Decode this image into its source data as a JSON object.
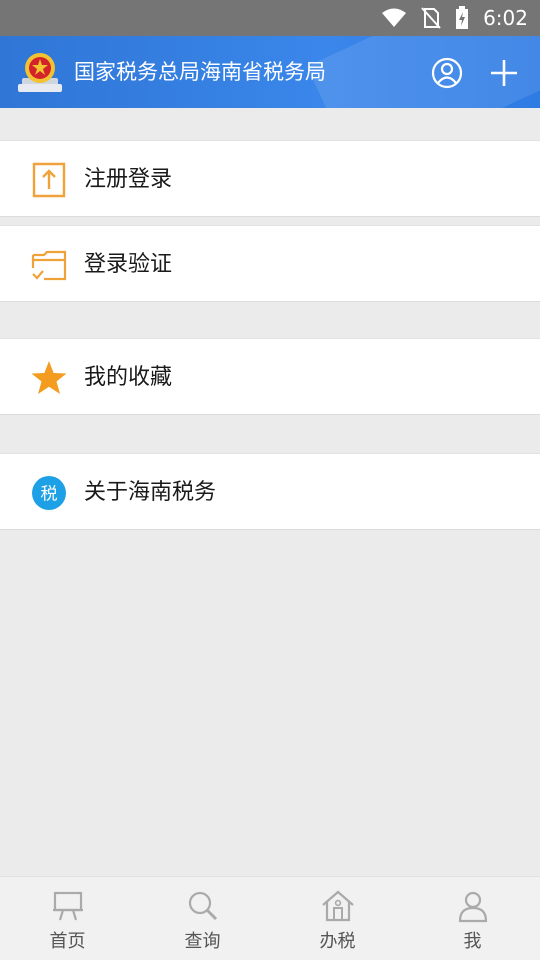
{
  "status_bar": {
    "time": "6:02"
  },
  "header": {
    "title": "国家税务总局海南省税务局"
  },
  "menu": [
    {
      "label": "注册登录",
      "icon": "upload-icon"
    },
    {
      "label": "登录验证",
      "icon": "folder-check-icon"
    },
    {
      "label": "我的收藏",
      "icon": "star-icon"
    },
    {
      "label": "关于海南税务",
      "icon": "tax-badge-icon",
      "badge_text": "税"
    }
  ],
  "nav": [
    {
      "label": "首页",
      "icon": "home-board-icon"
    },
    {
      "label": "查询",
      "icon": "search-icon"
    },
    {
      "label": "办税",
      "icon": "house-icon"
    },
    {
      "label": "我",
      "icon": "person-icon"
    }
  ],
  "colors": {
    "header": "#3a86ea",
    "accent_orange": "#f0a23a",
    "star": "#f39c1f",
    "badge": "#1ea0e6"
  }
}
